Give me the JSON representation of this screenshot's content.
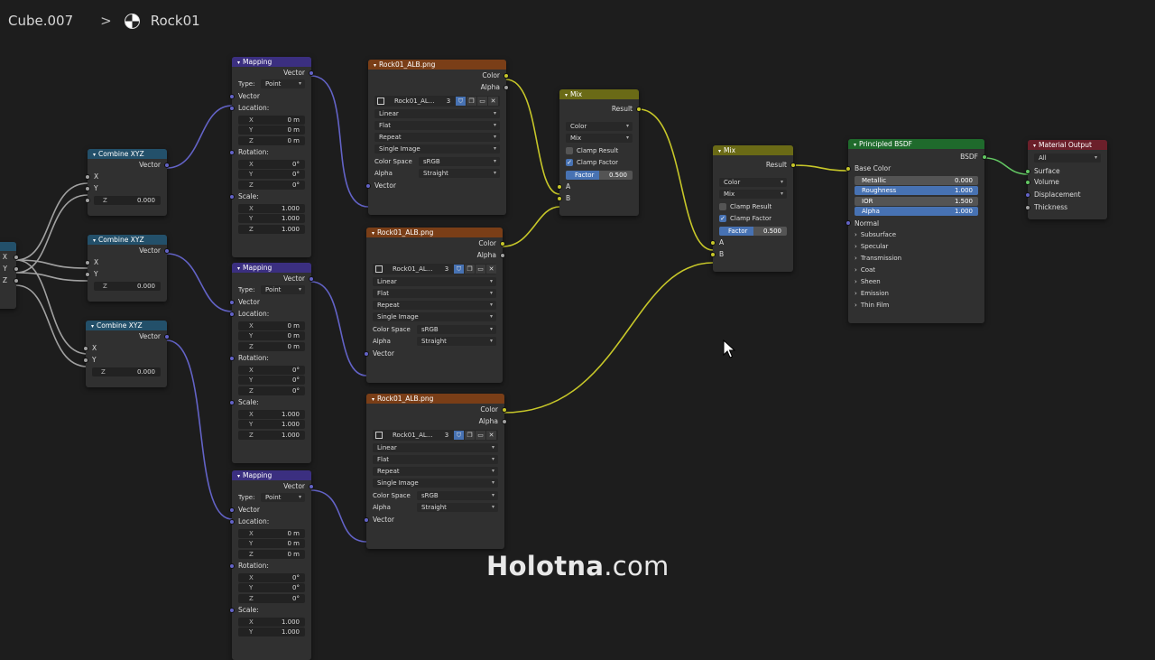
{
  "breadcrumb": {
    "object": "Cube.007",
    "material": "Rock01"
  },
  "watermark": {
    "brand": "Holotna",
    "domain": ".com"
  },
  "combine": {
    "title": "Combine XYZ",
    "out": "Vector",
    "x": "X",
    "y": "Y",
    "z": "Z",
    "z_val": "0.000"
  },
  "mapping": {
    "title": "Mapping",
    "out": "Vector",
    "type_label": "Type:",
    "type_val": "Point",
    "in_vector": "Vector",
    "location": "Location:",
    "rotation": "Rotation:",
    "scale": "Scale:",
    "x": "X",
    "y": "Y",
    "z": "Z",
    "loc_val": "0 m",
    "rot_val": "0°",
    "scale_val": "1.000"
  },
  "image": {
    "title": "Rock01_ALB.png",
    "color": "Color",
    "alpha": "Alpha",
    "img_name": "Rock01_AL...",
    "users": "3",
    "interp": "Linear",
    "projection": "Flat",
    "extension": "Repeat",
    "source": "Single Image",
    "colorspace_label": "Color Space",
    "colorspace": "sRGB",
    "alpha_label": "Alpha",
    "alpha_mode": "Straight",
    "vector": "Vector"
  },
  "mix": {
    "title": "Mix",
    "result": "Result",
    "dtype": "Color",
    "blend": "Mix",
    "clamp_result": "Clamp Result",
    "clamp_factor": "Clamp Factor",
    "factor": "Factor",
    "factor_val": "0.500",
    "factor_num": 0.5,
    "a": "A",
    "b": "B"
  },
  "bsdf": {
    "title": "Principled BSDF",
    "out": "BSDF",
    "base_color": "Base Color",
    "metallic": "Metallic",
    "metallic_val": "0.000",
    "roughness": "Roughness",
    "roughness_val": "1.000",
    "ior": "IOR",
    "ior_val": "1.500",
    "alpha": "Alpha",
    "alpha_val": "1.000",
    "normal": "Normal",
    "panels": [
      "Subsurface",
      "Specular",
      "Transmission",
      "Coat",
      "Sheen",
      "Emission",
      "Thin Film"
    ]
  },
  "output": {
    "title": "Material Output",
    "target": "All",
    "surface": "Surface",
    "volume": "Volume",
    "displacement": "Displacement",
    "thickness": "Thickness"
  },
  "left_node": {
    "x": "X",
    "y": "Y",
    "z": "Z"
  },
  "colors": {
    "canvas": "#1d1d1d",
    "vector_wire": "#6363c7",
    "color_wire": "#c7c729",
    "gray_wire": "#a1a1a1",
    "shader_wire": "#63c763"
  }
}
